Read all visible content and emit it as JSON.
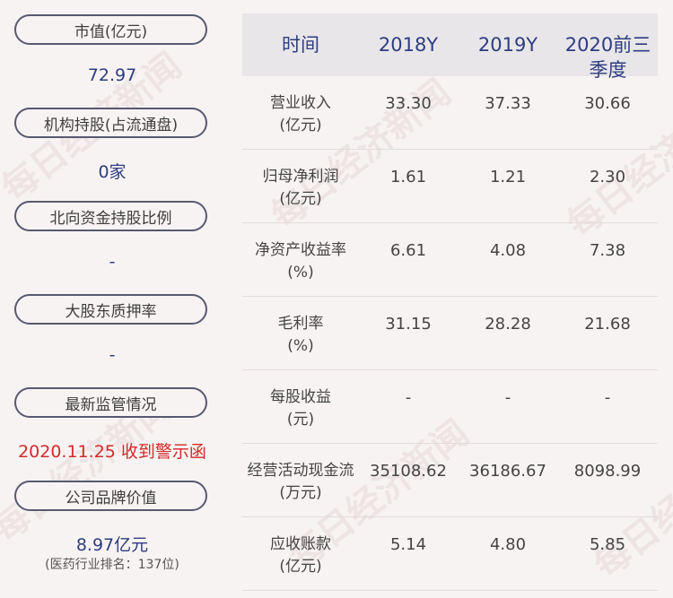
{
  "watermark": "每日经济新闻",
  "left_panel": {
    "items": [
      {
        "label": "市值(亿元)",
        "value": "72.97"
      },
      {
        "label": "机构持股(占流通盘)",
        "value": "0家"
      },
      {
        "label": "北向资金持股比例",
        "value": "-"
      },
      {
        "label": "大股东质押率",
        "value": "-"
      },
      {
        "label": "最新监管情况",
        "value": "2020.11.25 收到警示函"
      },
      {
        "label": "公司品牌价值",
        "value": "8.97亿元",
        "sub": "(医药行业排名：137位)"
      }
    ]
  },
  "table": {
    "headers": [
      "时间",
      "2018Y",
      "2019Y",
      "2020前三",
      "季度"
    ],
    "rows": [
      {
        "label1": "营业收入",
        "label2": "(亿元)",
        "values": [
          "33.30",
          "37.33",
          "30.66"
        ]
      },
      {
        "label1": "归母净利润",
        "label2": "(亿元)",
        "values": [
          "1.61",
          "1.21",
          "2.30"
        ]
      },
      {
        "label1": "净资产收益率",
        "label2": "(%)",
        "values": [
          "6.61",
          "4.08",
          "7.38"
        ]
      },
      {
        "label1": "毛利率",
        "label2": "(%)",
        "values": [
          "31.15",
          "28.28",
          "21.68"
        ]
      },
      {
        "label1": "每股收益",
        "label2": "(元)",
        "values": [
          "-",
          "-",
          "-"
        ]
      },
      {
        "label1": "经营活动现金流",
        "label2": "(万元)",
        "values": [
          "35108.62",
          "36186.67",
          "8098.99"
        ]
      },
      {
        "label1": "应收账款",
        "label2": "(亿元)",
        "values": [
          "5.14",
          "4.80",
          "5.85"
        ]
      }
    ]
  },
  "colors": {
    "accent_blue": "#2e3d80",
    "alert_red": "#d42a2a",
    "header_bg": "#e8e6e9"
  }
}
